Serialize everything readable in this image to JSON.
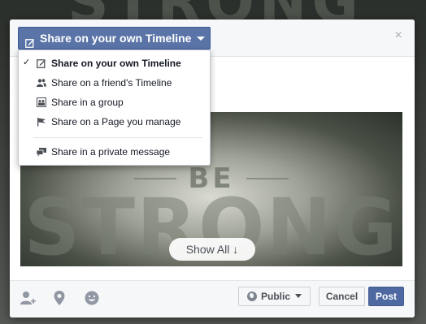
{
  "backdrop": {
    "text": "STRONG"
  },
  "share_button": {
    "label": "Share on your own Timeline",
    "icon": "compose-icon"
  },
  "share_menu": {
    "items": [
      {
        "label": "Share on your own Timeline",
        "icon": "compose-icon",
        "selected": true
      },
      {
        "label": "Share on a friend's Timeline",
        "icon": "friends-icon",
        "selected": false
      },
      {
        "label": "Share in a group",
        "icon": "group-icon",
        "selected": false
      },
      {
        "label": "Share on a Page you manage",
        "icon": "flag-icon",
        "selected": false
      },
      {
        "label": "Share in a private message",
        "icon": "message-icon",
        "selected": false
      }
    ],
    "check_mark": "✓"
  },
  "dialog": {
    "close_glyph": "×",
    "image": {
      "small_text": "BE",
      "large_text": "STRONG"
    },
    "show_all_label": "Show All ↓"
  },
  "footer": {
    "icons": [
      "tag-friends-icon",
      "location-pin-icon",
      "emoji-icon"
    ],
    "audience_label": "Public",
    "cancel_label": "Cancel",
    "post_label": "Post"
  },
  "colors": {
    "brand_blue": "#4e69a2",
    "dropdown_blue": "#5b74a8",
    "header_bg": "#f6f7f8"
  }
}
